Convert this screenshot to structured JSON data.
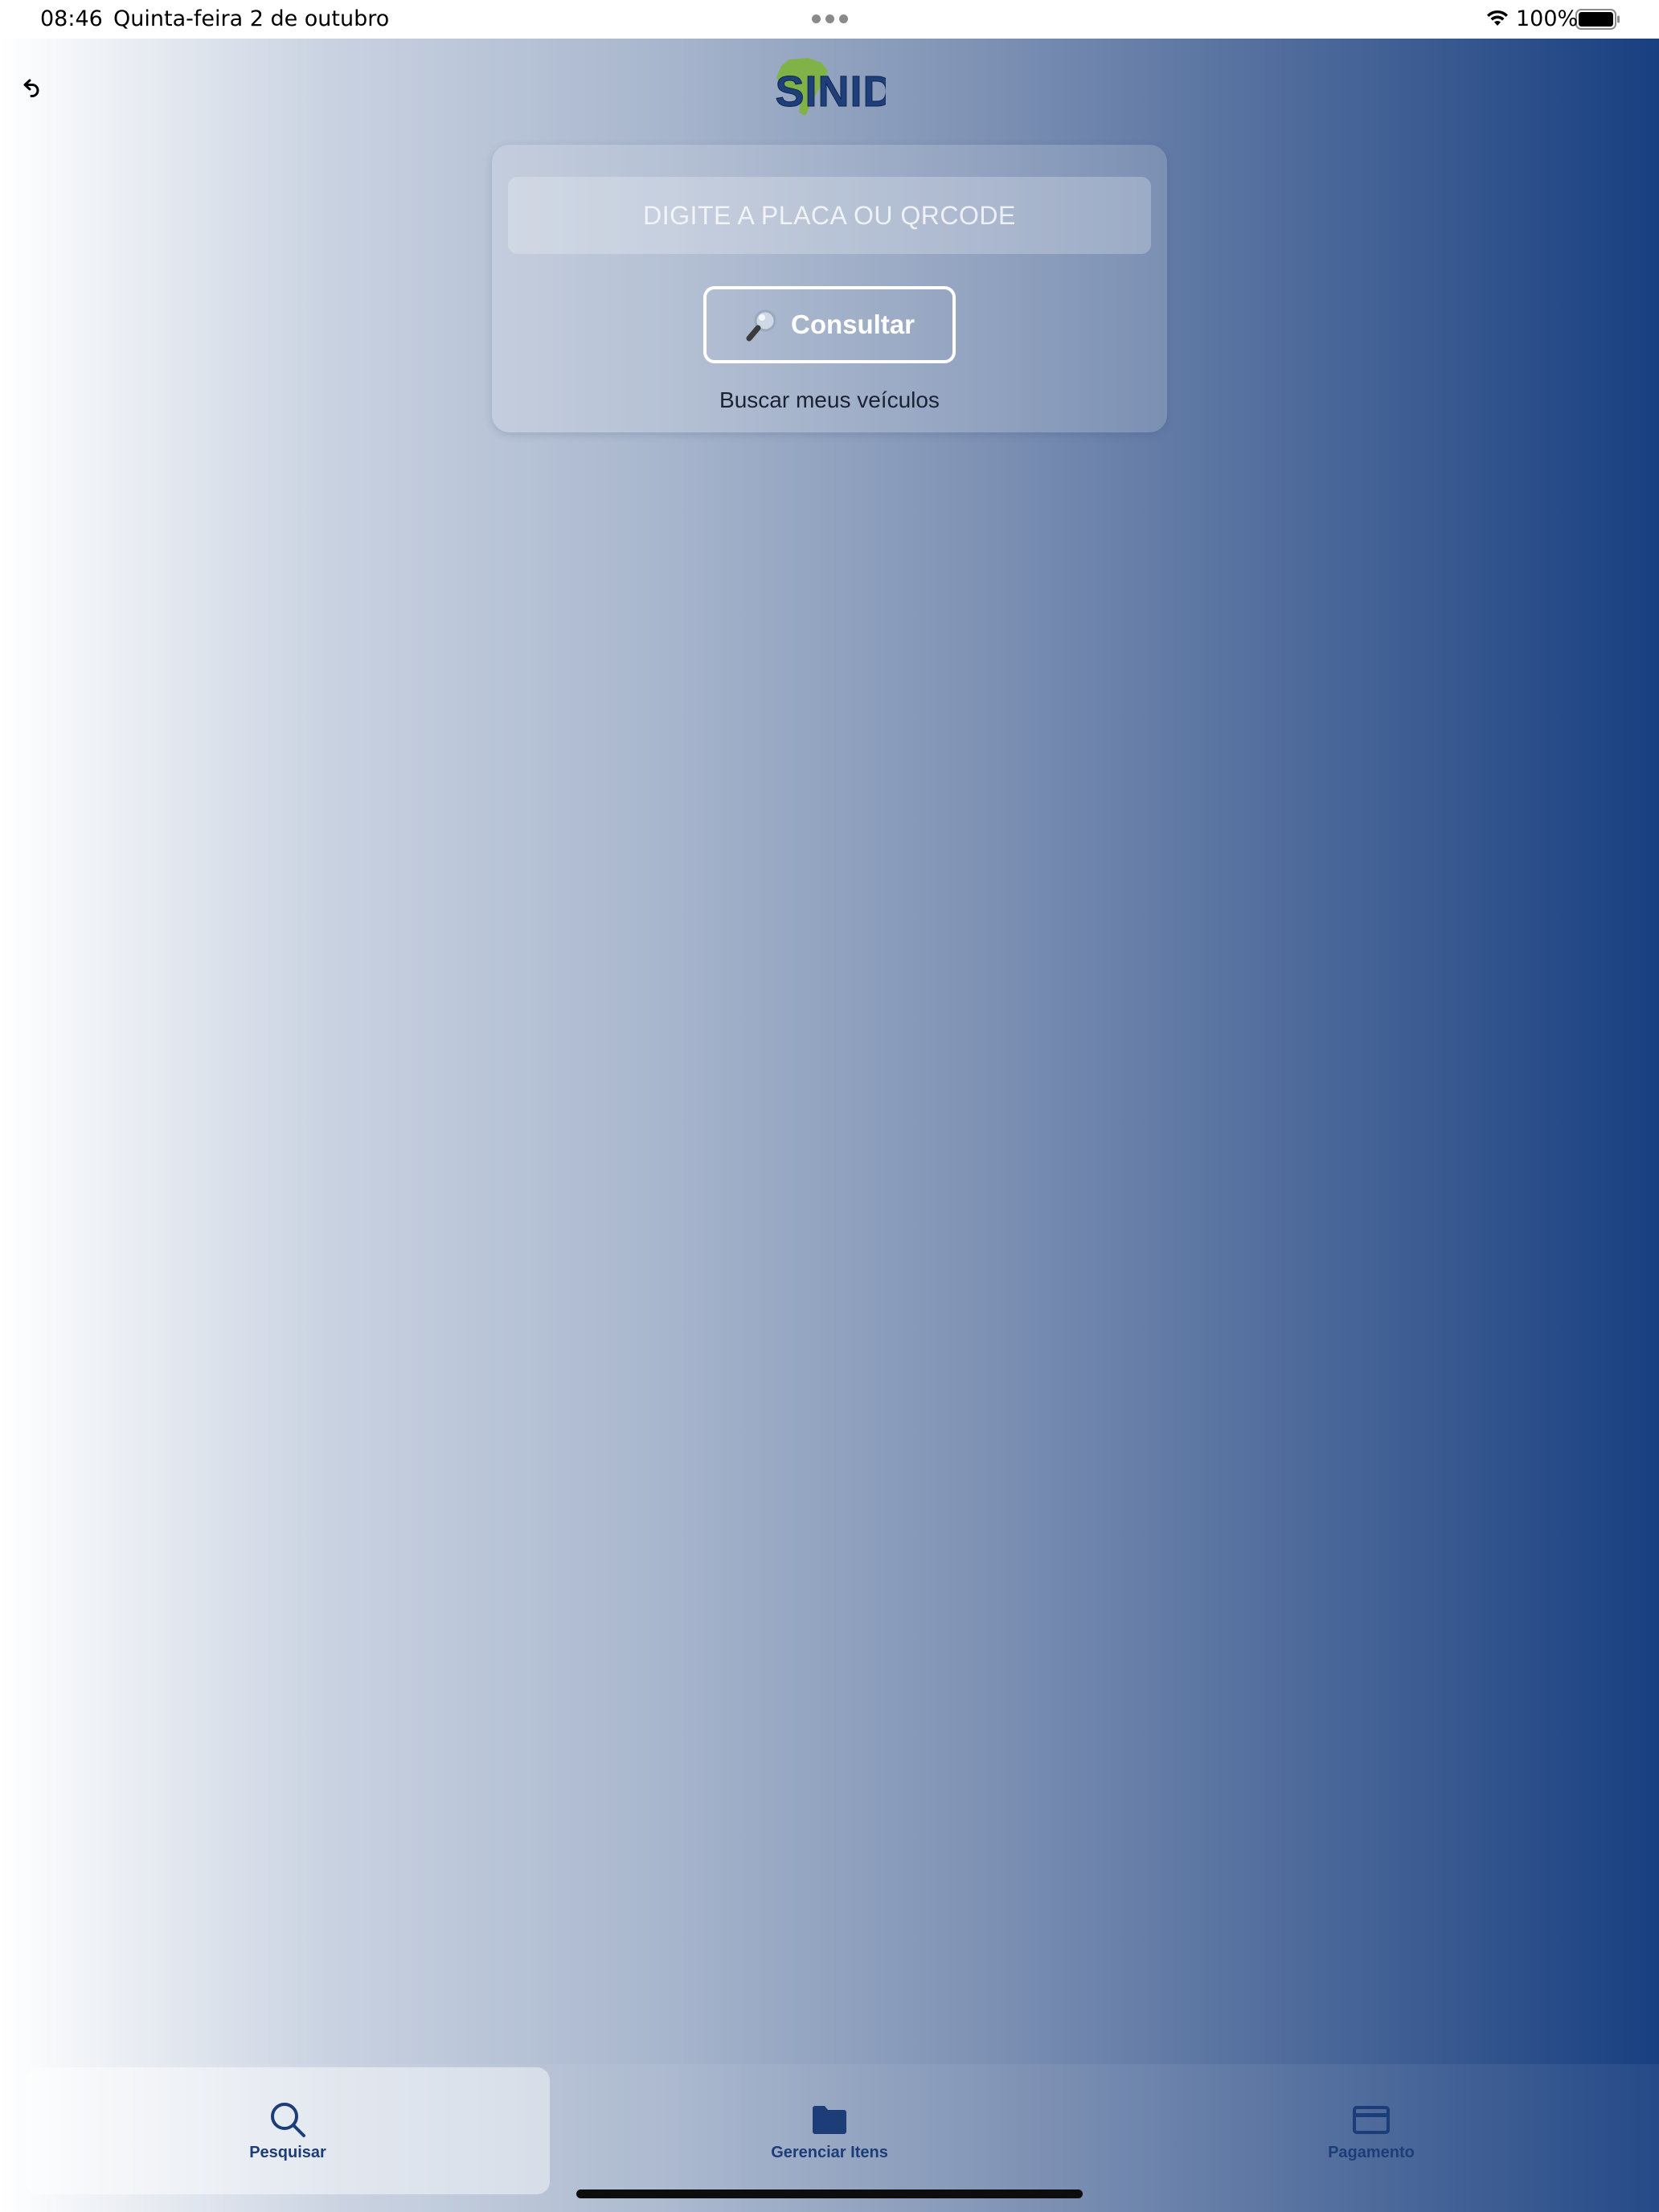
{
  "status_bar": {
    "time": "08:46",
    "date": "Quinta-feira 2 de outubro",
    "battery_percent": "100%"
  },
  "icons": {
    "back": "undo-arrow-icon",
    "wifi": "wifi-icon",
    "battery": "battery-full-icon",
    "consult": "magnifying-glass-icon",
    "search_tab": "search-icon",
    "manage_tab": "folder-icon",
    "payment_tab": "credit-card-icon"
  },
  "logo": {
    "text": "SINID"
  },
  "search": {
    "input_value": "",
    "placeholder": "DIGITE A PLACA OU QRCODE",
    "consult_label": "Consultar",
    "my_vehicles_label": "Buscar meus veículos"
  },
  "tabs": [
    {
      "label": "Pesquisar",
      "active": true
    },
    {
      "label": "Gerenciar Itens",
      "active": false
    },
    {
      "label": "Pagamento",
      "active": false
    }
  ],
  "colors": {
    "gradient_start": "#ffffff",
    "gradient_end": "#183f80",
    "tab_label": "#1d3d78",
    "logo_green": "#7db43a",
    "logo_blue": "#1f3f7a"
  }
}
